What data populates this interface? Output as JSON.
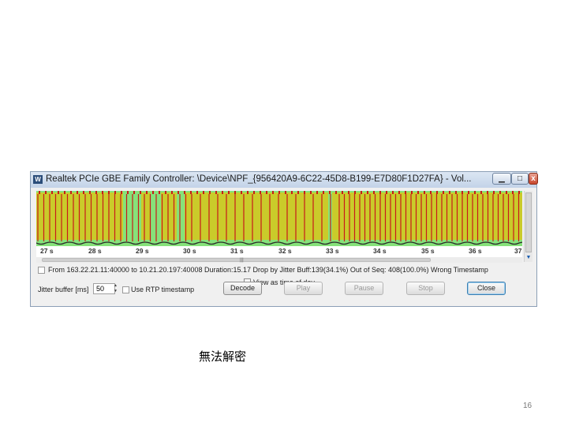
{
  "window": {
    "icon_glyph": "W",
    "title": "Realtek PCIe GBE Family Controller: \\Device\\NPF_{956420A9-6C22-45D8-B199-E7D80F1D27FA} - Vol...",
    "minimize_label": "▁",
    "maximize_label": "□",
    "close_label": "x"
  },
  "graph": {
    "colors": {
      "background": "#86e27a",
      "band": "#d6c71c",
      "packet_line": "#c81a1a",
      "drop_mark": "#c81a1a"
    }
  },
  "time_axis": {
    "ticks": [
      "27 s",
      "28 s",
      "29 s",
      "30 s",
      "31 s",
      "32 s",
      "33 s",
      "34 s",
      "35 s",
      "36 s",
      "37"
    ]
  },
  "info": {
    "text": "From 163.22.21.11:40000 to 10.21.20.197:40008   Duration:15.17   Drop by Jitter Buff:139(34.1%)   Out of Seq: 408(100.0%)   Wrong Timestamp"
  },
  "view_as_time_of_day": {
    "label": "View as time of day"
  },
  "controls": {
    "jitter_label": "Jitter buffer [ms]",
    "jitter_value": "50",
    "rtp_label": "Use RTP timestamp",
    "decode_label": "Decode",
    "play_label": "Play",
    "pause_label": "Pause",
    "stop_label": "Stop",
    "close_label": "Close"
  },
  "caption": "無法解密",
  "page_number": "16"
}
